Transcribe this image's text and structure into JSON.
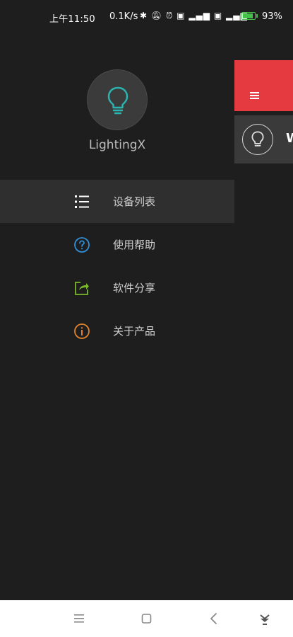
{
  "status_bar": {
    "time": "上午11:50",
    "network_speed": "0.1K/s",
    "battery_percent_text": "93%",
    "battery_level": 0.93,
    "icons": [
      "bluetooth-icon",
      "mute-icon",
      "alarm-icon",
      "hd-icon",
      "signal-4g-icon",
      "signal-4g-icon",
      "battery-icon"
    ]
  },
  "drawer": {
    "app_name": "LightingX",
    "menu": [
      {
        "label": "设备列表",
        "icon": "list-icon",
        "color": "#ffffff",
        "active": true
      },
      {
        "label": "使用帮助",
        "icon": "help-icon",
        "color": "#2f8fd8",
        "active": false
      },
      {
        "label": "软件分享",
        "icon": "share-icon",
        "color": "#7ab82a",
        "active": false
      },
      {
        "label": "关于产品",
        "icon": "info-icon",
        "color": "#e0812b",
        "active": false
      }
    ]
  },
  "main_peek": {
    "header_color": "#e53a3f",
    "device_initial": "W"
  },
  "colors": {
    "background": "#1e1e1e",
    "accent_bulb": "#2bb5b0"
  },
  "nav_bar": {
    "buttons": [
      "menu-nav-icon",
      "home-nav-icon",
      "back-nav-icon",
      "download-nav-icon"
    ]
  }
}
